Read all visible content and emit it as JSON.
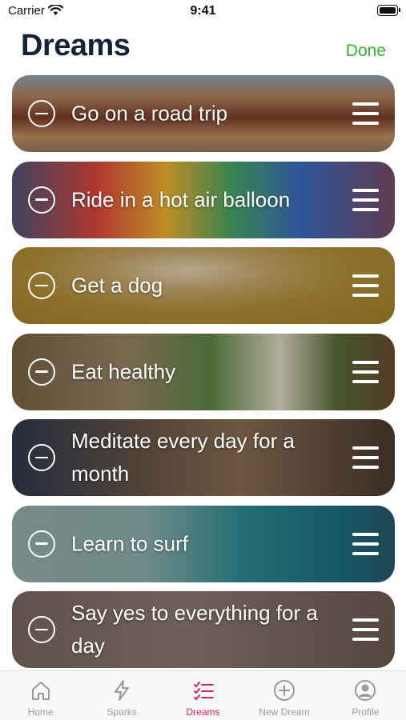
{
  "status_bar": {
    "carrier": "Carrier",
    "time": "9:41"
  },
  "header": {
    "title": "Dreams",
    "done_label": "Done"
  },
  "dreams": [
    {
      "title": "Go on a road trip"
    },
    {
      "title": "Ride in a hot air balloon"
    },
    {
      "title": "Get a dog"
    },
    {
      "title": "Eat healthy"
    },
    {
      "title": "Meditate every day for a month"
    },
    {
      "title": "Learn to surf"
    },
    {
      "title": "Say yes to everything for a day"
    }
  ],
  "tab_bar": {
    "active": "Dreams",
    "active_color": "#e0245e",
    "inactive_color": "#9a9a9a",
    "tabs": [
      {
        "label": "Home",
        "icon": "home-icon"
      },
      {
        "label": "Sparks",
        "icon": "lightning-icon"
      },
      {
        "label": "Dreams",
        "icon": "checklist-icon"
      },
      {
        "label": "New Dream",
        "icon": "plus-circle-icon"
      },
      {
        "label": "Profile",
        "icon": "person-circle-icon"
      }
    ]
  }
}
